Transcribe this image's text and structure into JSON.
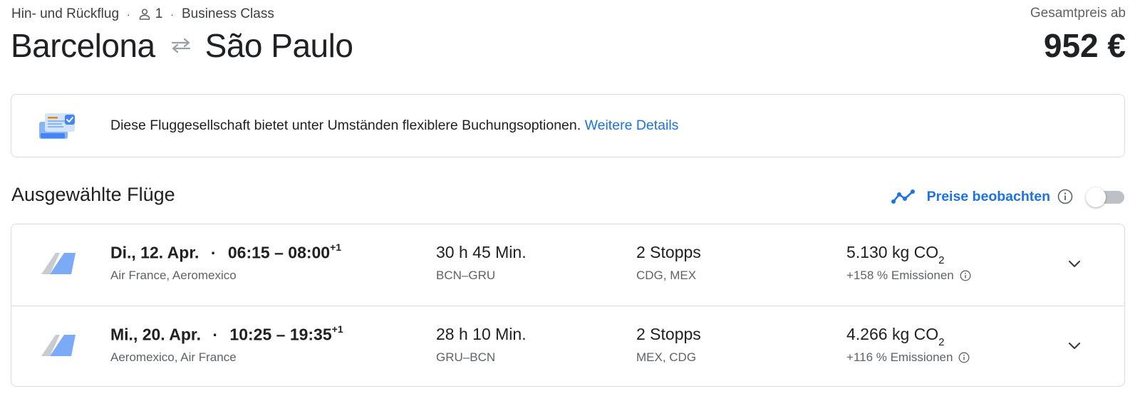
{
  "header": {
    "trip_type": "Hin- und Rückflug",
    "separator": "·",
    "passengers": "1",
    "cabin_class": "Business Class",
    "origin": "Barcelona",
    "destination": "São Paulo",
    "price_label": "Gesamtpreis ab",
    "price_value": "952 €"
  },
  "notice": {
    "text": "Diese Fluggesellschaft bietet unter Umständen flexiblere Buchungsoptionen.",
    "link": "Weitere Details"
  },
  "section": {
    "title": "Ausgewählte Flüge",
    "track_label": "Preise beobachten",
    "track_enabled": false
  },
  "flights": [
    {
      "date": "Di., 12. Apr.",
      "times": "06:15 – 08:00",
      "day_offset": "+1",
      "airlines": "Air France, Aeromexico",
      "duration": "30 h 45 Min.",
      "airports": "BCN–GRU",
      "stops": "2 Stopps",
      "stop_codes": "CDG, MEX",
      "co2_value": "5.130 kg CO",
      "co2_sub": "2",
      "emissions": "+158 % Emissionen"
    },
    {
      "date": "Mi., 20. Apr.",
      "times": "10:25 – 19:35",
      "day_offset": "+1",
      "airlines": "Aeromexico, Air France",
      "duration": "28 h 10 Min.",
      "airports": "GRU–BCN",
      "stops": "2 Stopps",
      "stop_codes": "MEX, CDG",
      "co2_value": "4.266 kg CO",
      "co2_sub": "2",
      "emissions": "+116 % Emissionen"
    }
  ],
  "colors": {
    "accent": "#1a73e8",
    "text_primary": "#202124",
    "text_secondary": "#5f6368",
    "border": "#dadce0"
  },
  "icons": {
    "person": "person-icon",
    "swap": "swap-arrows-icon",
    "notice": "booking-options-illustration-icon",
    "trend": "price-trend-icon",
    "info": "info-icon",
    "airline": "airline-tail-logo-icon",
    "expand": "chevron-down-icon"
  }
}
